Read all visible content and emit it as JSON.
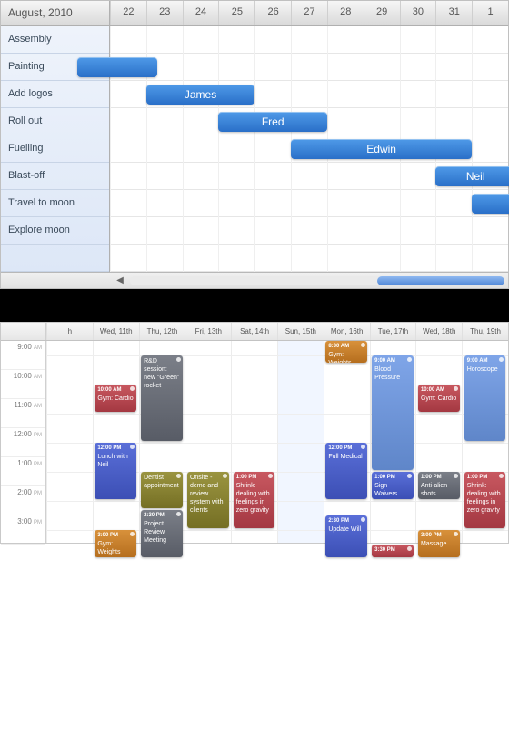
{
  "gantt": {
    "month_label": "August, 2010",
    "days": [
      "22",
      "23",
      "24",
      "25",
      "26",
      "27",
      "28",
      "29",
      "30",
      "31",
      "1"
    ],
    "tasks": [
      "Assembly",
      "Painting",
      "Add logos",
      "Roll out",
      "Fuelling",
      "Blast-off",
      "Travel to moon",
      "Explore moon"
    ],
    "bars": [
      {
        "row": 1,
        "label": "",
        "start_col": 0,
        "span": 2.2,
        "offset": -0.9
      },
      {
        "row": 2,
        "label": "James",
        "start_col": 1.0,
        "span": 3
      },
      {
        "row": 3,
        "label": "Fred",
        "start_col": 3.0,
        "span": 3
      },
      {
        "row": 4,
        "label": "Edwin",
        "start_col": 5.0,
        "span": 5
      },
      {
        "row": 5,
        "label": "Neil",
        "start_col": 9.0,
        "span": 2.2
      },
      {
        "row": 6,
        "label": "",
        "start_col": 10.0,
        "span": 1.2
      }
    ]
  },
  "week": {
    "days": [
      "h",
      "Wed, 11th",
      "Thu, 12th",
      "Fri, 13th",
      "Sat, 14th",
      "Sun, 15th",
      "Mon, 16th",
      "Tue, 17th",
      "Wed, 18th",
      "Thu, 19th"
    ],
    "today_index": 5,
    "time_slots": [
      {
        "h": "9:00",
        "ap": "AM"
      },
      {
        "h": "10:00",
        "ap": "AM"
      },
      {
        "h": "11:00",
        "ap": "AM"
      },
      {
        "h": "12:00",
        "ap": "PM"
      },
      {
        "h": "1:00",
        "ap": "PM"
      },
      {
        "h": "2:00",
        "ap": "PM"
      },
      {
        "h": "3:00",
        "ap": "PM"
      }
    ],
    "events": [
      {
        "day": 1,
        "start": 10,
        "end": 11,
        "color": "red",
        "time": "10:00 AM",
        "title": "Gym: Cardio"
      },
      {
        "day": 1,
        "start": 12,
        "end": 14,
        "color": "blue",
        "time": "12:00 PM",
        "title": "Lunch with Neil"
      },
      {
        "day": 1,
        "start": 15,
        "end": 16,
        "color": "orange",
        "time": "3:00 PM",
        "title": "Gym: Weights"
      },
      {
        "day": 2,
        "start": 9,
        "end": 12,
        "color": "gray",
        "time": "",
        "title": "R&D session: new \"Green\" rocket"
      },
      {
        "day": 2,
        "start": 13,
        "end": 14.3,
        "color": "olive",
        "time": "",
        "title": "Dentist appointment"
      },
      {
        "day": 2,
        "start": 14.3,
        "end": 16,
        "color": "gray",
        "time": "2:30 PM",
        "title": "Project Review Meeting"
      },
      {
        "day": 3,
        "start": 13,
        "end": 15,
        "color": "olive",
        "time": "",
        "title": "Onsite - demo and review system with clients"
      },
      {
        "day": 4,
        "start": 13,
        "end": 15,
        "color": "red",
        "time": "1:00 PM",
        "title": "Shrink: dealing with feelings in zero gravity"
      },
      {
        "day": 6,
        "start": 8.5,
        "end": 9.3,
        "color": "orange",
        "time": "8:30 AM",
        "title": "Gym: Weights"
      },
      {
        "day": 6,
        "start": 12,
        "end": 14,
        "color": "blue",
        "time": "12:00 PM",
        "title": "Full Medical"
      },
      {
        "day": 6,
        "start": 14.5,
        "end": 16,
        "color": "blue",
        "time": "2:30 PM",
        "title": "Update Will"
      },
      {
        "day": 7,
        "start": 9,
        "end": 13,
        "color": "ltblue",
        "time": "9:00 AM",
        "title": "Blood Pressure"
      },
      {
        "day": 7,
        "start": 13,
        "end": 14,
        "color": "blue",
        "time": "1:00 PM",
        "title": "Sign Waivers"
      },
      {
        "day": 7,
        "start": 15.5,
        "end": 16,
        "color": "red",
        "time": "3:30 PM",
        "title": ""
      },
      {
        "day": 8,
        "start": 10,
        "end": 11,
        "color": "red",
        "time": "10:00 AM",
        "title": "Gym: Cardio"
      },
      {
        "day": 8,
        "start": 13,
        "end": 14,
        "color": "gray",
        "time": "1:00 PM",
        "title": "Anti-alien shots"
      },
      {
        "day": 8,
        "start": 15,
        "end": 16,
        "color": "orange",
        "time": "3:00 PM",
        "title": "Massage"
      },
      {
        "day": 9,
        "start": 9,
        "end": 12,
        "color": "ltblue",
        "time": "9:00 AM",
        "title": "Horoscope"
      },
      {
        "day": 9,
        "start": 13,
        "end": 15,
        "color": "red",
        "time": "1:00 PM",
        "title": "Shrink: dealing with feelings in zero gravity"
      }
    ]
  },
  "colors": {
    "accent": "#3f7dd6"
  }
}
